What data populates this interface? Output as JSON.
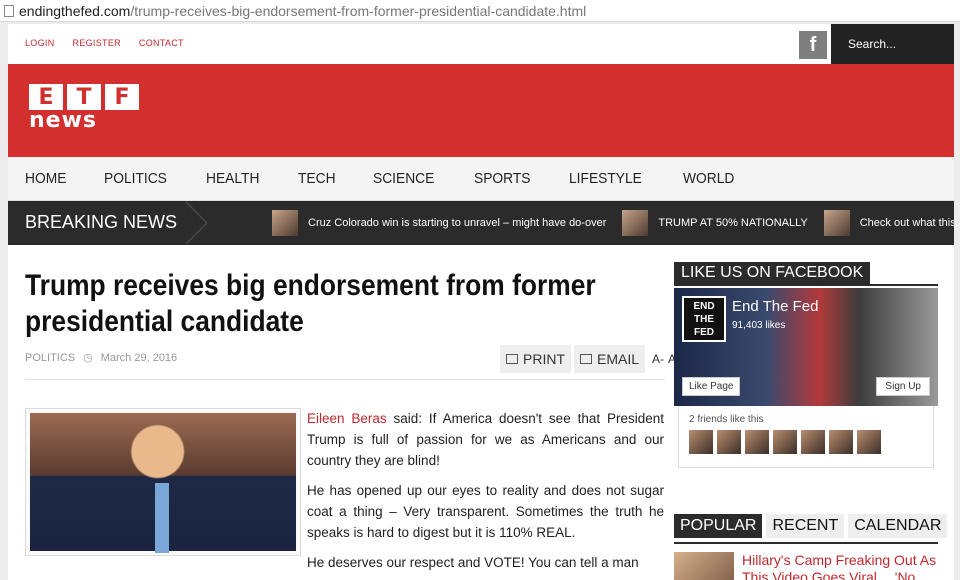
{
  "browser": {
    "url_host": "endingthefed.com",
    "url_path": "/trump-receives-big-endorsement-from-former-presidential-candidate.html"
  },
  "top_links": [
    "LOGIN",
    "REGISTER",
    "CONTACT"
  ],
  "facebook_icon": "f",
  "search_placeholder": "Search...",
  "logo": {
    "letters": [
      "E",
      "T",
      "F"
    ],
    "word": "news"
  },
  "nav": [
    "HOME",
    "POLITICS",
    "HEALTH",
    "TECH",
    "SCIENCE",
    "SPORTS",
    "LIFESTYLE",
    "WORLD"
  ],
  "breaking": {
    "label": "BREAKING NEWS",
    "items": [
      "Cruz Colorado win is starting to unravel – might have do-over",
      "TRUMP AT 50% NATIONALLY",
      "Check out what this Bil"
    ]
  },
  "article": {
    "title": "Trump receives big endorsement from former presidential candidate",
    "category": "POLITICS",
    "date": "March 29, 2016",
    "print_label": "PRINT",
    "email_label": "EMAIL",
    "font_smaller": "A-",
    "font_larger": "A+",
    "author": "Eileen Beras",
    "p1_rest": " said: If America doesn't see that President Trump is full of passion for we as Americans and our country they are blind!",
    "p2": "He has opened up our eyes to reality and does not sugar coat a thing – Very transparent. Sometimes the truth he speaks is hard to digest but it is 110% REAL.",
    "p3": "He deserves our respect and VOTE! You can tell a man"
  },
  "sidebar": {
    "fb_heading": "LIKE US ON FACEBOOK",
    "fb_logo_lines": [
      "END",
      "THE",
      "FED"
    ],
    "fb_page_name": "End The Fed",
    "fb_likes": "91,403 likes",
    "fb_like_btn": "Like Page",
    "fb_signup_btn": "Sign Up",
    "friends_text": "2 friends like this",
    "tabs": [
      "POPULAR",
      "RECENT",
      "CALENDAR"
    ],
    "popular_title": "Hillary's Camp Freaking Out As This Video Goes Viral… 'No Way To Stop It Now'"
  },
  "colors": {
    "brand_red": "#d32f2f",
    "dark": "#2b2b2b",
    "link_red": "#c0272d"
  }
}
